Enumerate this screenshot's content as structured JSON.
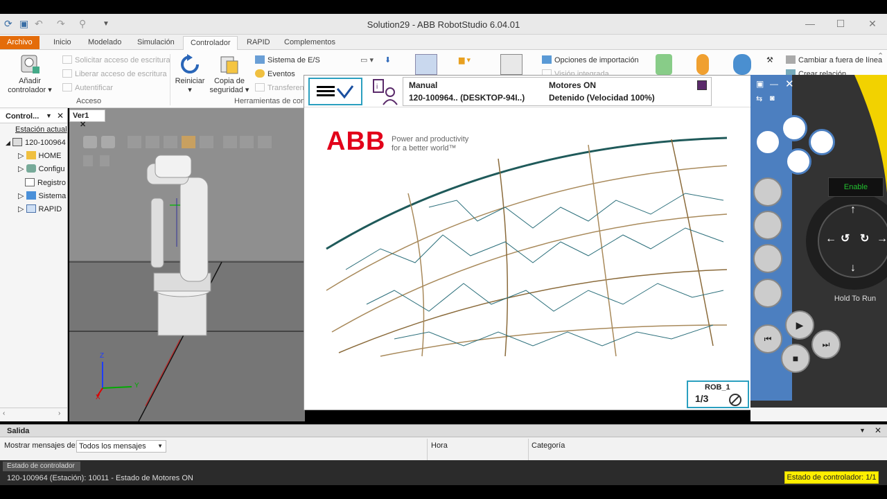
{
  "window": {
    "title": "Solution29 - ABB RobotStudio 6.04.01"
  },
  "ribbon_tabs": [
    "Archivo",
    "Inicio",
    "Modelado",
    "Simulación",
    "Controlador",
    "RAPID",
    "Complementos"
  ],
  "ribbon": {
    "add_controller": "Añadir controlador",
    "request_write": "Solicitar acceso de escritura",
    "release_write": "Liberar acceso de escritura",
    "authenticate": "Autentificar",
    "group_access": "Acceso",
    "restart": "Reiniciar",
    "backup": "Copia de seguridad",
    "io_system": "Sistema de E/S",
    "events": "Eventos",
    "transfer": "Transferen",
    "group_tools": "Herramientas de cont",
    "import_options": "Opciones de importación",
    "integrated_vision": "Visión integrada",
    "change_offline": "Cambiar a fuera de línea",
    "create_relation": "Crear relación"
  },
  "left_panel": {
    "title": "Control...",
    "current_station": "Estación actual",
    "tree": [
      "120-100964",
      "HOME",
      "Configu",
      "Registro",
      "Sistema",
      "RAPID"
    ]
  },
  "viewport": {
    "tab": "Ver1",
    "axes": {
      "z": "Z",
      "y": "Y",
      "x": "X"
    }
  },
  "flexpendant": {
    "mode": "Manual",
    "controller": "120-100964.. (DESKTOP-94I..)",
    "motors": "Motores ON",
    "state": "Detenido (Velocidad 100%)",
    "brand": "ABB",
    "tagline1": "Power and productivity",
    "tagline2": "for a better world™",
    "rob_label": "ROB_1",
    "rob_fraction": "1/3"
  },
  "joystick": {
    "enable": "Enable",
    "hold_to_run": "Hold To Run"
  },
  "output": {
    "tab": "Salida",
    "filter_label": "Mostrar mensajes de:",
    "filter_value": "Todos los mensajes",
    "col_time": "Hora",
    "col_category": "Categoría"
  },
  "status": {
    "tab": "Estado de controlador",
    "message": "120-100964 (Estación): 10011 - Estado de Motores ON",
    "badge": "Estado de controlador: 1/1"
  }
}
